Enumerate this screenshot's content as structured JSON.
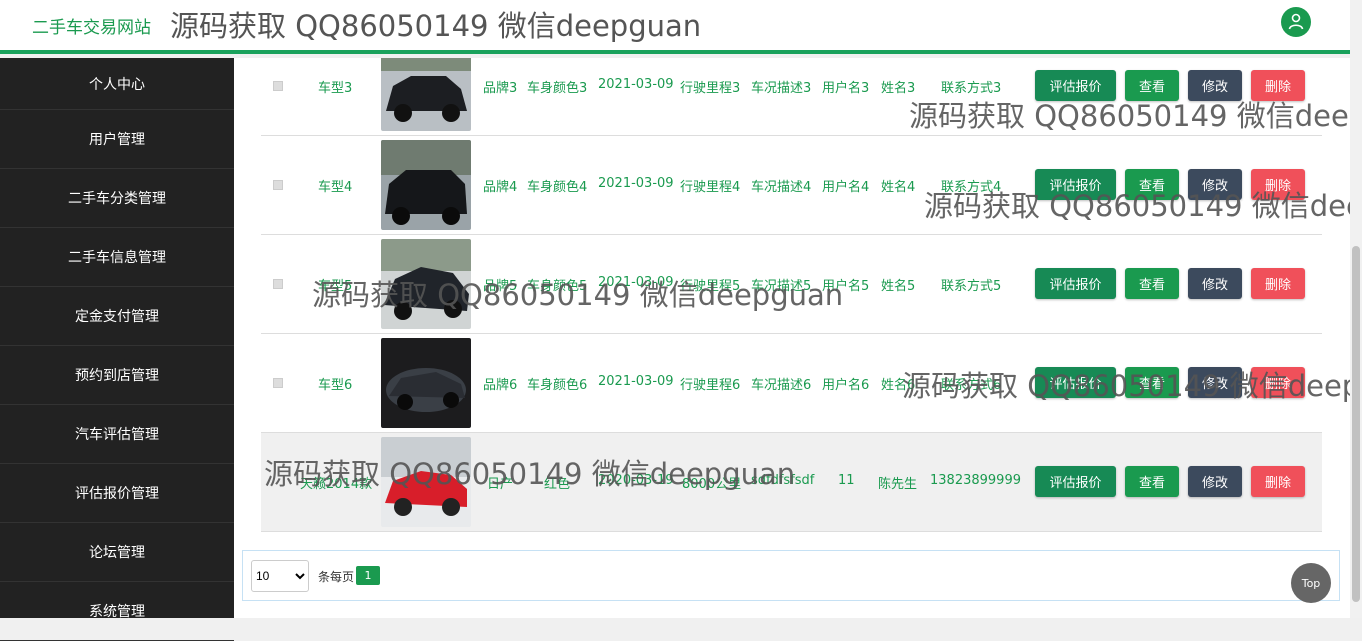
{
  "header": {
    "brand": "二手车交易网站",
    "watermark": "源码获取 QQ86050149 微信deepguan"
  },
  "sidebar": {
    "items": [
      {
        "label": "个人中心"
      },
      {
        "label": "用户管理"
      },
      {
        "label": "二手车分类管理"
      },
      {
        "label": "二手车信息管理"
      },
      {
        "label": "定金支付管理"
      },
      {
        "label": "预约到店管理"
      },
      {
        "label": "汽车评估管理"
      },
      {
        "label": "评估报价管理"
      },
      {
        "label": "论坛管理"
      },
      {
        "label": "系统管理"
      }
    ]
  },
  "table": {
    "rows": [
      {
        "name": "车型3",
        "brand": "品牌3",
        "color": "车身颜色3",
        "date": "2021-03-09",
        "mileage": "行驶里程3",
        "condition": "车况描述3",
        "user": "用户名3",
        "realname": "姓名3",
        "contact": "联系方式3"
      },
      {
        "name": "车型4",
        "brand": "品牌4",
        "color": "车身颜色4",
        "date": "2021-03-09",
        "mileage": "行驶里程4",
        "condition": "车况描述4",
        "user": "用户名4",
        "realname": "姓名4",
        "contact": "联系方式4"
      },
      {
        "name": "车型5",
        "brand": "品牌5",
        "color": "车身颜色5",
        "date": "2021-03-09",
        "mileage": "行驶里程5",
        "condition": "车况描述5",
        "user": "用户名5",
        "realname": "姓名5",
        "contact": "联系方式5"
      },
      {
        "name": "车型6",
        "brand": "品牌6",
        "color": "车身颜色6",
        "date": "2021-03-09",
        "mileage": "行驶里程6",
        "condition": "车况描述6",
        "user": "用户名6",
        "realname": "姓名6",
        "contact": "联系方式6"
      },
      {
        "name": "天籁2014款",
        "brand": "日产",
        "color": "红色",
        "date": "2020-03-19",
        "mileage": "8000公里",
        "condition": "sdfdfsfsdf",
        "user": "11",
        "realname": "陈先生",
        "contact": "13823899999"
      }
    ],
    "buttons": {
      "evaluate": "评估报价",
      "view": "查看",
      "edit": "修改",
      "delete": "删除"
    }
  },
  "pager": {
    "page_size": "10",
    "per_page_label": "条每页",
    "current_page": "1"
  },
  "top_button": "Top",
  "watermark": "源码获取 QQ86050149 微信deepguan",
  "colors": {
    "accent": "#1a9a4f",
    "sidebar": "#222222",
    "delete": "#f0505a",
    "edit": "#3c4a5d"
  }
}
